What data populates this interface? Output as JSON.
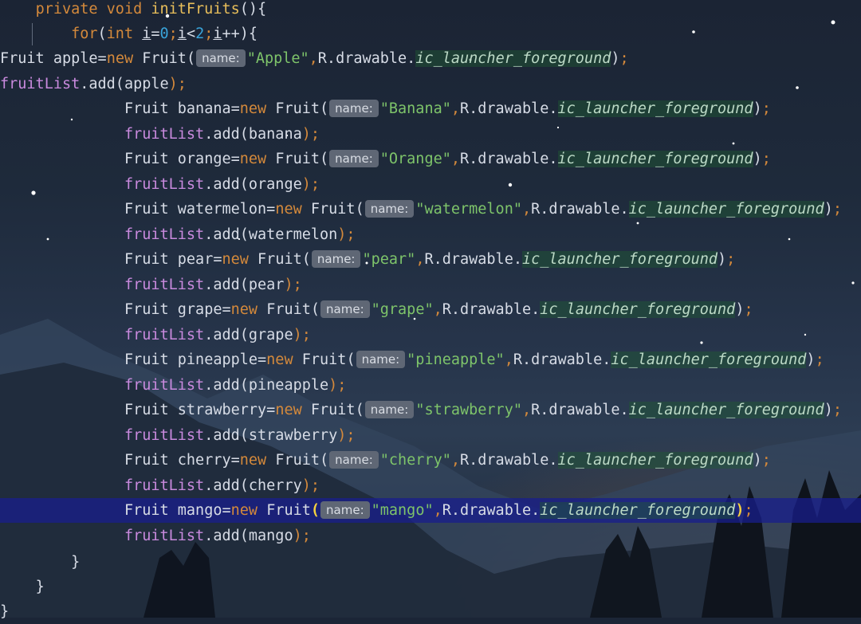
{
  "editor": {
    "method": {
      "modifiers": "private void",
      "name": "initFruits",
      "params": "(){"
    },
    "loop": {
      "kw_for": "for",
      "open": "(",
      "kw_int": "int",
      "var": "i",
      "eq": "=",
      "start": "0",
      "semi1": ";",
      "lt": "<",
      "end": "2",
      "semi2": ";",
      "inc": "++){"
    },
    "hint_label": "name:",
    "fruits": [
      {
        "var": "apple",
        "name": "\"Apple\""
      },
      {
        "var": "banana",
        "name": "\"Banana\""
      },
      {
        "var": "orange",
        "name": "\"Orange\""
      },
      {
        "var": "watermelon",
        "name": "\"watermelon\""
      },
      {
        "var": "pear",
        "name": "\"pear\""
      },
      {
        "var": "grape",
        "name": "\"grape\""
      },
      {
        "var": "pineapple",
        "name": "\"pineapple\""
      },
      {
        "var": "strawberry",
        "name": "\"strawberry\""
      },
      {
        "var": "cherry",
        "name": "\"cherry\""
      },
      {
        "var": "mango",
        "name": "\"mango\""
      }
    ],
    "tokens": {
      "type": "Fruit",
      "kw_new": "new",
      "resource_prefix": "R.drawable.",
      "resource_name": "ic_launcher_foreground",
      "list": "fruitList",
      "add_call": ".add(",
      "close_stmt": ");"
    },
    "closing_braces": [
      "}",
      "}",
      "}"
    ],
    "current_line_var": "mango"
  },
  "colors": {
    "keyword": "#d4893b",
    "number": "#39a3d9",
    "string": "#7ec46a",
    "field": "#c98ade",
    "method": "#e8be5a",
    "current_line": "#181e8c"
  }
}
